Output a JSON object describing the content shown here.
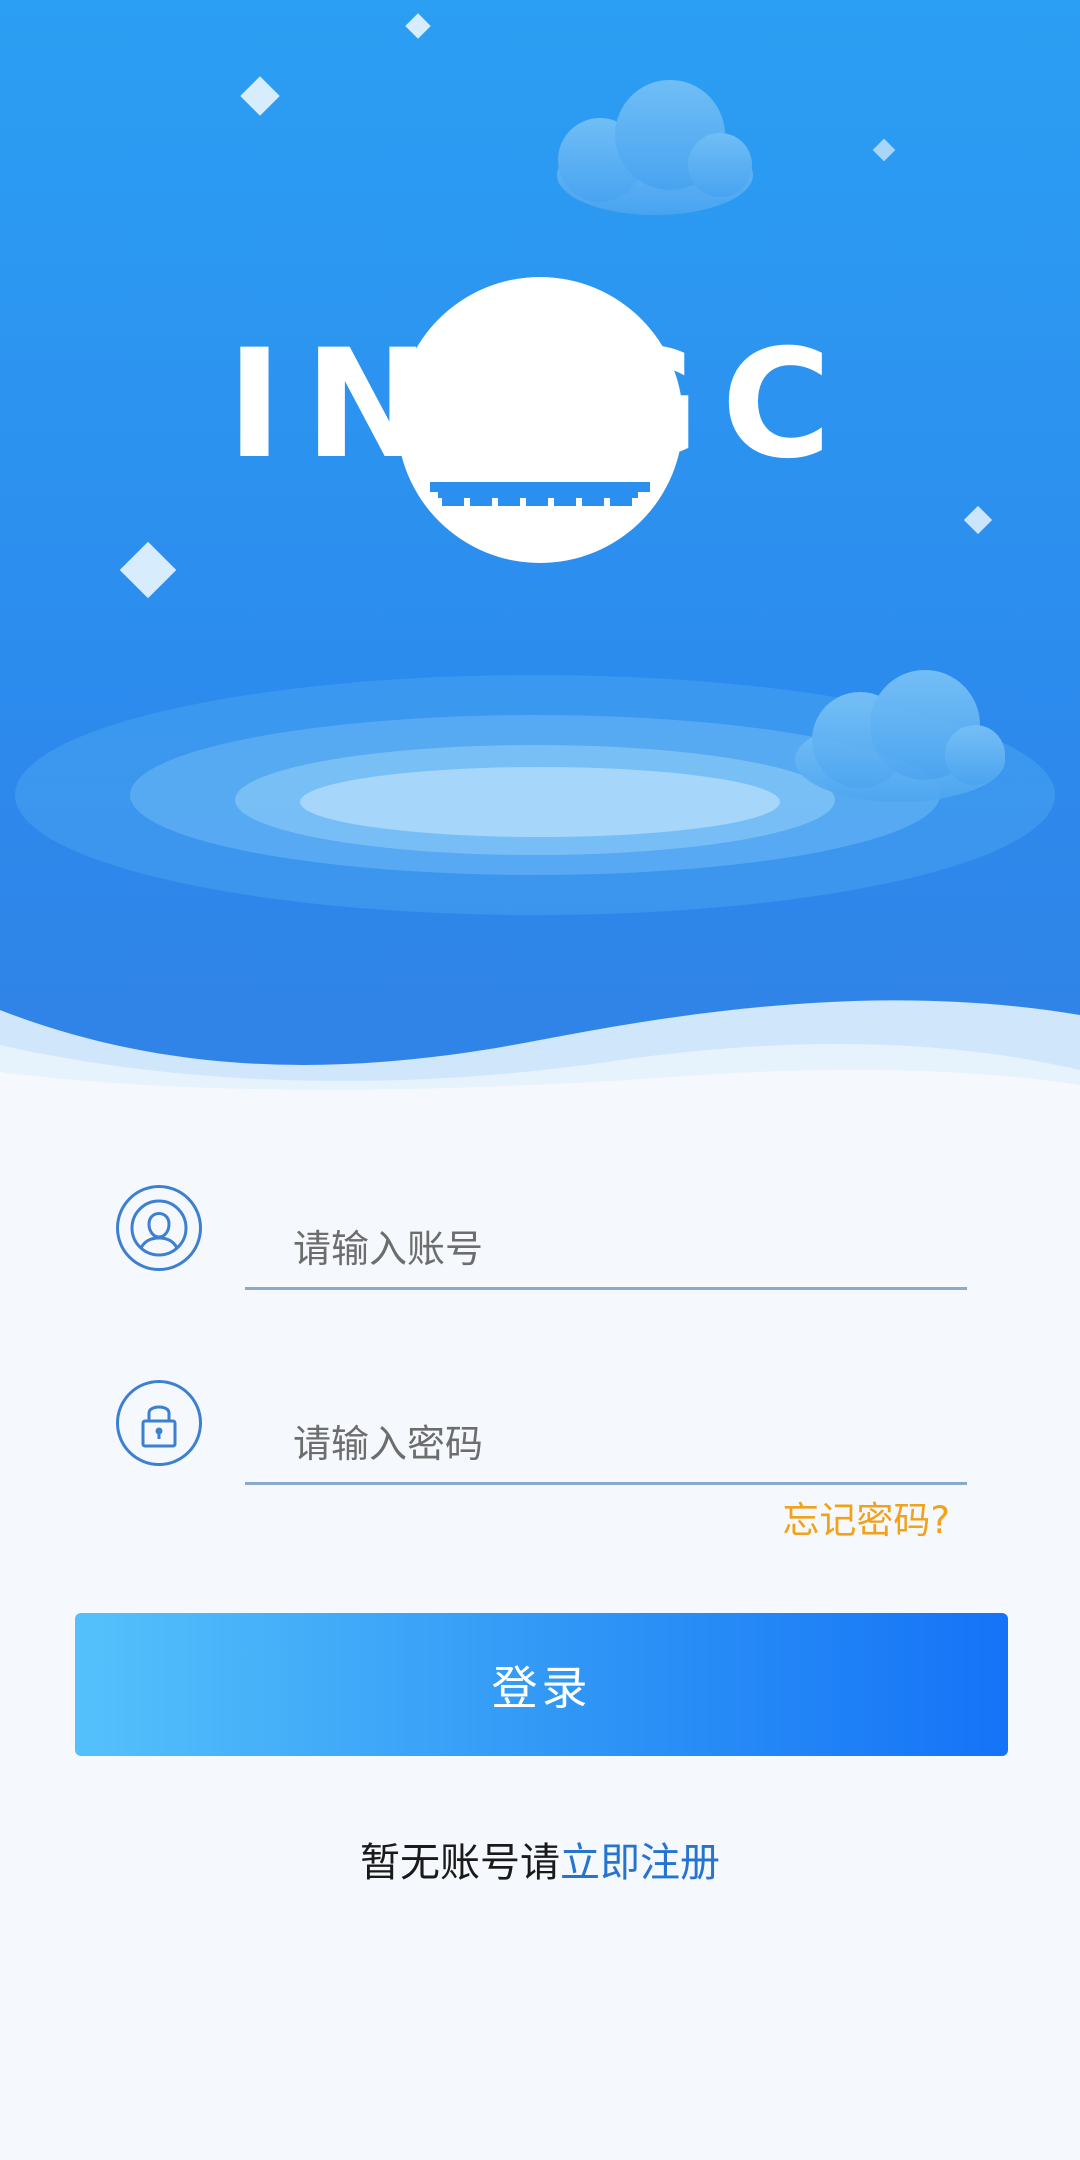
{
  "logo": {
    "text": "INTGC"
  },
  "account_field": {
    "placeholder": "请输入账号",
    "value": "",
    "icon": "user-icon"
  },
  "password_field": {
    "placeholder": "请输入密码",
    "value": "",
    "icon": "lock-icon"
  },
  "forgot_password": {
    "label": "忘记密码?"
  },
  "login_button": {
    "label": "登录"
  },
  "register": {
    "prompt": "暂无账号请",
    "link_label": "立即注册"
  },
  "colors": {
    "hero_top": "#2b9cf3",
    "hero_bottom": "#2f82e9",
    "icon_blue": "#3d7fd0",
    "forgot_orange": "#f0a21c",
    "button_start": "#55c1fb",
    "button_end": "#1473f7",
    "link_blue": "#2574cf"
  }
}
